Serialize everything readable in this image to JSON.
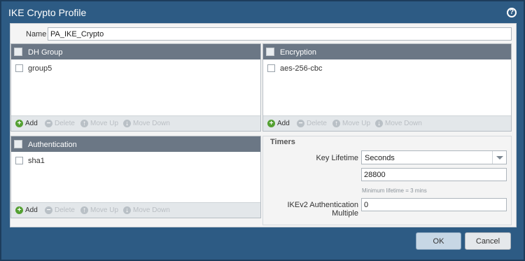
{
  "dialog": {
    "title": "IKE Crypto Profile",
    "help_icon": "question-circle-icon"
  },
  "name": {
    "label": "Name",
    "value": "PA_IKE_Crypto"
  },
  "dh_group": {
    "header": "DH Group",
    "items": [
      "group5"
    ]
  },
  "encryption": {
    "header": "Encryption",
    "items": [
      "aes-256-cbc"
    ]
  },
  "authentication": {
    "header": "Authentication",
    "items": [
      "sha1"
    ]
  },
  "toolbar": {
    "add": "Add",
    "delete": "Delete",
    "move_up": "Move Up",
    "move_down": "Move Down"
  },
  "timers": {
    "title": "Timers",
    "key_lifetime_label": "Key Lifetime",
    "key_lifetime_unit": "Seconds",
    "key_lifetime_value": "28800",
    "min_lifetime_hint": "Minimum lifetime = 3 mins",
    "ikev2_label_line1": "IKEv2 Authentication",
    "ikev2_label_line2": "Multiple",
    "ikev2_value": "0"
  },
  "buttons": {
    "ok": "OK",
    "cancel": "Cancel"
  },
  "colors": {
    "frame": "#2d5b84",
    "panel_header": "#6b7785",
    "add_icon": "#54a032",
    "ok_button": "#c7d7e5"
  }
}
